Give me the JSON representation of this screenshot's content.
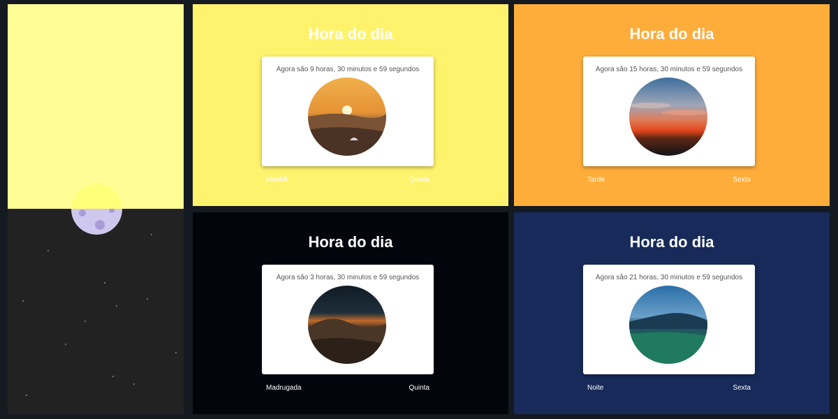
{
  "colors": {
    "page_background": "#151a21",
    "sky_day": "#fffd95",
    "sky_night": "#222222",
    "moon": "#cfc8ee",
    "morning_panel": "#fff36d",
    "afternoon_panel": "#ffad3a",
    "dawn_panel": "#03050d",
    "night_panel": "#172a59"
  },
  "panels": [
    {
      "title": "Hora do dia",
      "time_text": "Agora são 9 horas, 30 minutos e 59 segundos",
      "period": "Manhã",
      "weekday": "Quinta",
      "scene": "sunrise-desert"
    },
    {
      "title": "Hora do dia",
      "time_text": "Agora são 15 horas, 30 minutos e 59 segundos",
      "period": "Tarde",
      "weekday": "Sexta",
      "scene": "sunset-clouds"
    },
    {
      "title": "Hora do dia",
      "time_text": "Agora são 3 horas, 30 minutos e 59 segundos",
      "period": "Madrugada",
      "weekday": "Quinta",
      "scene": "night-mountains"
    },
    {
      "title": "Hora do dia",
      "time_text": "Agora são 21 horas, 30 minutos e 59 segundos",
      "period": "Noite",
      "weekday": "Sexta",
      "scene": "evening-valley"
    }
  ]
}
